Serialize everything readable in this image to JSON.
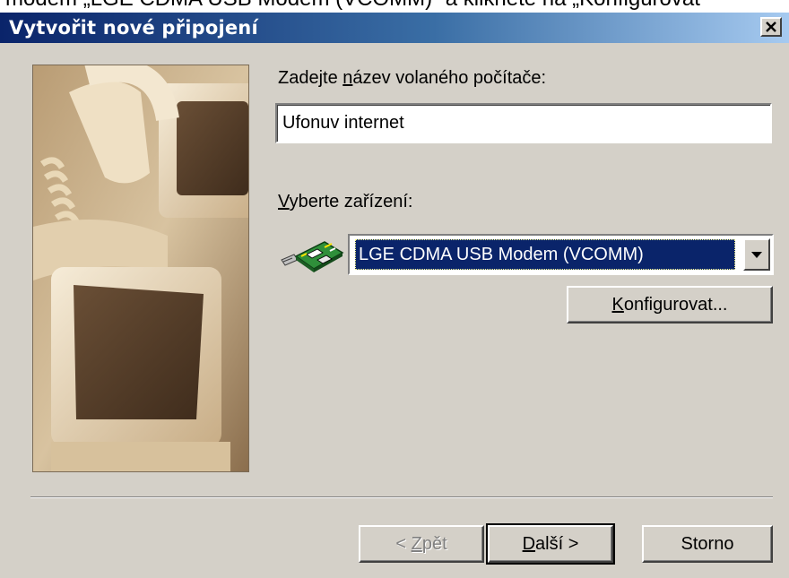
{
  "top_caption": "modem „LGE CDMA USB Modem (VCOMM)“ a klikněte na „Konfigurovat",
  "window": {
    "title": "Vytvořit nové připojení",
    "close_glyph": "×"
  },
  "computer_name": {
    "label_before": "Zadejte ",
    "label_underlined": "n",
    "label_after": "ázev volaného počítače:",
    "value": "Ufonuv internet"
  },
  "device": {
    "label_underlined": "V",
    "label_after": "yberte zařízení:",
    "selected": "LGE CDMA USB Modem (VCOMM)",
    "icon": "modem-icon"
  },
  "buttons": {
    "configure_underlined": "K",
    "configure_after": "onfigurovat...",
    "back_before": "< ",
    "back_underlined": "Z",
    "back_after": "pět",
    "next_underlined": "D",
    "next_after": "alší >",
    "cancel": "Storno"
  },
  "colors": {
    "dialog_bg": "#d4d0c8",
    "title_start": "#0a246a",
    "title_end": "#a6caf0",
    "selection": "#0a246a"
  }
}
